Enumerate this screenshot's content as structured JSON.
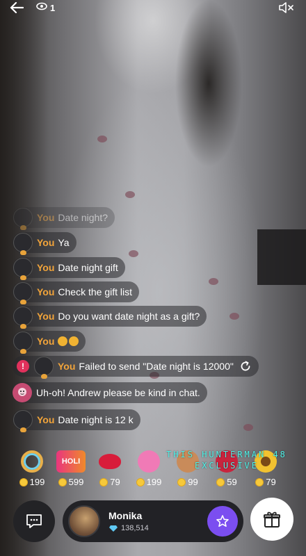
{
  "top_bar": {
    "viewer_count": "1"
  },
  "chat": {
    "messages": [
      {
        "name": "You",
        "text": "Date night?"
      },
      {
        "name": "You",
        "text": "Ya"
      },
      {
        "name": "You",
        "text": "Date night gift"
      },
      {
        "name": "You",
        "text": "Check the gift list"
      },
      {
        "name": "You",
        "text": "Do you want date night as a gift?"
      },
      {
        "name": "You",
        "text": ""
      },
      {
        "name": "You",
        "text": "Failed to send \"Date night is 12000\"",
        "error_badge": "!"
      },
      {
        "name": "",
        "text": "Uh-oh! Andrew please be kind in chat."
      },
      {
        "name": "You",
        "text": "Date night is 12 k"
      }
    ]
  },
  "gifts": [
    {
      "icon": "rainbow-ring-icon",
      "label": "",
      "price": "199",
      "color": "#e8b04a"
    },
    {
      "icon": "holi-icon",
      "label": "HOLI",
      "price": "599",
      "color": "#e9357e"
    },
    {
      "icon": "lips-icon",
      "label": "",
      "price": "79",
      "color": "#d81c3a"
    },
    {
      "icon": "heart-bear-icon",
      "label": "",
      "price": "199",
      "color": "#f07ab6"
    },
    {
      "icon": "teddy-icon",
      "label": "",
      "price": "99",
      "color": "#c98b5a"
    },
    {
      "icon": "love-bomb-icon",
      "label": "",
      "price": "59",
      "color": "#c8243d"
    },
    {
      "icon": "sunflower-icon",
      "label": "",
      "price": "79",
      "color": "#f2c230"
    }
  ],
  "watermark": {
    "line1": "THIS HUNTERMAN 48",
    "line2": "EXCLUSIVE"
  },
  "host": {
    "name": "Monika",
    "diamonds": "138,514"
  },
  "colors": {
    "username": "#f2a43a",
    "follow_button": "#7b4ef0",
    "error_badge": "#e1315c",
    "coin": "#f6c93b"
  }
}
